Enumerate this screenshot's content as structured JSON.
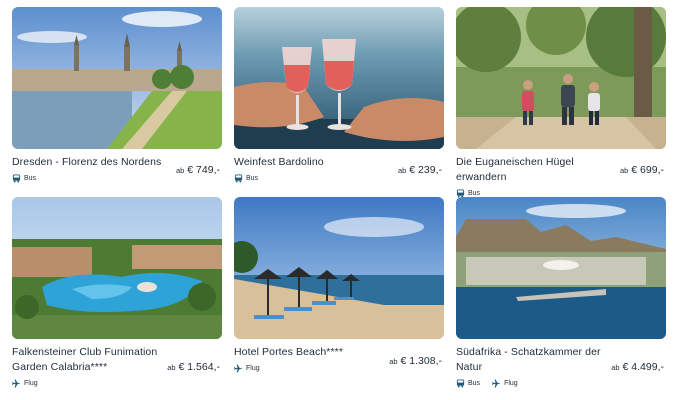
{
  "cards": [
    {
      "title": "Dresden - Florenz des Nordens",
      "price_prefix": "ab",
      "price": "€ 749,-",
      "transport": [
        "Bus"
      ]
    },
    {
      "title": "Weinfest Bardolino",
      "price_prefix": "ab",
      "price": "€ 239,-",
      "transport": [
        "Bus"
      ]
    },
    {
      "title": "Die Euganeischen Hügel erwandern",
      "price_prefix": "ab",
      "price": "€ 699,-",
      "transport": [
        "Bus"
      ]
    },
    {
      "title": "Falkensteiner Club Funimation Garden Calabria****",
      "price_prefix": "ab",
      "price": "€ 1.564,-",
      "transport": [
        "Flug"
      ]
    },
    {
      "title": "Hotel Portes Beach****",
      "price_prefix": "ab",
      "price": "€ 1.308,-",
      "transport": [
        "Flug"
      ]
    },
    {
      "title": "Südafrika - Schatzkammer der Natur",
      "price_prefix": "ab",
      "price": "€ 4.499,-",
      "transport": [
        "Bus",
        "Flug"
      ]
    }
  ],
  "icons": {
    "bus": "bus-icon",
    "flight": "plane-icon"
  },
  "colors": {
    "icon": "#1e5a7a",
    "text": "#1f2a37"
  }
}
